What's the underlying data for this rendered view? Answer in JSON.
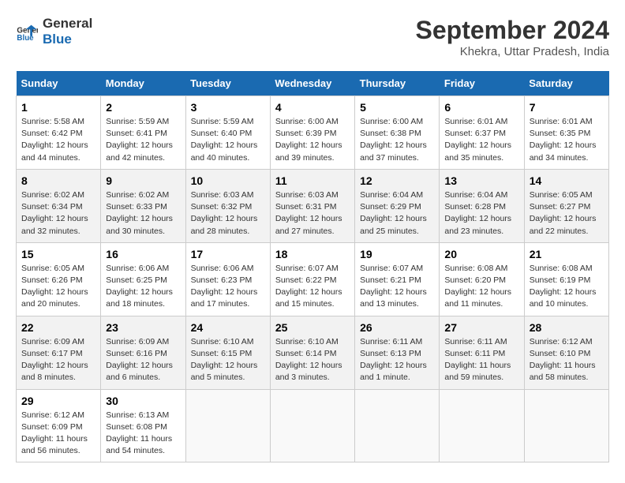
{
  "header": {
    "logo_line1": "General",
    "logo_line2": "Blue",
    "month_year": "September 2024",
    "location": "Khekra, Uttar Pradesh, India"
  },
  "days_of_week": [
    "Sunday",
    "Monday",
    "Tuesday",
    "Wednesday",
    "Thursday",
    "Friday",
    "Saturday"
  ],
  "weeks": [
    [
      {
        "day": "1",
        "info": "Sunrise: 5:58 AM\nSunset: 6:42 PM\nDaylight: 12 hours\nand 44 minutes."
      },
      {
        "day": "2",
        "info": "Sunrise: 5:59 AM\nSunset: 6:41 PM\nDaylight: 12 hours\nand 42 minutes."
      },
      {
        "day": "3",
        "info": "Sunrise: 5:59 AM\nSunset: 6:40 PM\nDaylight: 12 hours\nand 40 minutes."
      },
      {
        "day": "4",
        "info": "Sunrise: 6:00 AM\nSunset: 6:39 PM\nDaylight: 12 hours\nand 39 minutes."
      },
      {
        "day": "5",
        "info": "Sunrise: 6:00 AM\nSunset: 6:38 PM\nDaylight: 12 hours\nand 37 minutes."
      },
      {
        "day": "6",
        "info": "Sunrise: 6:01 AM\nSunset: 6:37 PM\nDaylight: 12 hours\nand 35 minutes."
      },
      {
        "day": "7",
        "info": "Sunrise: 6:01 AM\nSunset: 6:35 PM\nDaylight: 12 hours\nand 34 minutes."
      }
    ],
    [
      {
        "day": "8",
        "info": "Sunrise: 6:02 AM\nSunset: 6:34 PM\nDaylight: 12 hours\nand 32 minutes."
      },
      {
        "day": "9",
        "info": "Sunrise: 6:02 AM\nSunset: 6:33 PM\nDaylight: 12 hours\nand 30 minutes."
      },
      {
        "day": "10",
        "info": "Sunrise: 6:03 AM\nSunset: 6:32 PM\nDaylight: 12 hours\nand 28 minutes."
      },
      {
        "day": "11",
        "info": "Sunrise: 6:03 AM\nSunset: 6:31 PM\nDaylight: 12 hours\nand 27 minutes."
      },
      {
        "day": "12",
        "info": "Sunrise: 6:04 AM\nSunset: 6:29 PM\nDaylight: 12 hours\nand 25 minutes."
      },
      {
        "day": "13",
        "info": "Sunrise: 6:04 AM\nSunset: 6:28 PM\nDaylight: 12 hours\nand 23 minutes."
      },
      {
        "day": "14",
        "info": "Sunrise: 6:05 AM\nSunset: 6:27 PM\nDaylight: 12 hours\nand 22 minutes."
      }
    ],
    [
      {
        "day": "15",
        "info": "Sunrise: 6:05 AM\nSunset: 6:26 PM\nDaylight: 12 hours\nand 20 minutes."
      },
      {
        "day": "16",
        "info": "Sunrise: 6:06 AM\nSunset: 6:25 PM\nDaylight: 12 hours\nand 18 minutes."
      },
      {
        "day": "17",
        "info": "Sunrise: 6:06 AM\nSunset: 6:23 PM\nDaylight: 12 hours\nand 17 minutes."
      },
      {
        "day": "18",
        "info": "Sunrise: 6:07 AM\nSunset: 6:22 PM\nDaylight: 12 hours\nand 15 minutes."
      },
      {
        "day": "19",
        "info": "Sunrise: 6:07 AM\nSunset: 6:21 PM\nDaylight: 12 hours\nand 13 minutes."
      },
      {
        "day": "20",
        "info": "Sunrise: 6:08 AM\nSunset: 6:20 PM\nDaylight: 12 hours\nand 11 minutes."
      },
      {
        "day": "21",
        "info": "Sunrise: 6:08 AM\nSunset: 6:19 PM\nDaylight: 12 hours\nand 10 minutes."
      }
    ],
    [
      {
        "day": "22",
        "info": "Sunrise: 6:09 AM\nSunset: 6:17 PM\nDaylight: 12 hours\nand 8 minutes."
      },
      {
        "day": "23",
        "info": "Sunrise: 6:09 AM\nSunset: 6:16 PM\nDaylight: 12 hours\nand 6 minutes."
      },
      {
        "day": "24",
        "info": "Sunrise: 6:10 AM\nSunset: 6:15 PM\nDaylight: 12 hours\nand 5 minutes."
      },
      {
        "day": "25",
        "info": "Sunrise: 6:10 AM\nSunset: 6:14 PM\nDaylight: 12 hours\nand 3 minutes."
      },
      {
        "day": "26",
        "info": "Sunrise: 6:11 AM\nSunset: 6:13 PM\nDaylight: 12 hours\nand 1 minute."
      },
      {
        "day": "27",
        "info": "Sunrise: 6:11 AM\nSunset: 6:11 PM\nDaylight: 11 hours\nand 59 minutes."
      },
      {
        "day": "28",
        "info": "Sunrise: 6:12 AM\nSunset: 6:10 PM\nDaylight: 11 hours\nand 58 minutes."
      }
    ],
    [
      {
        "day": "29",
        "info": "Sunrise: 6:12 AM\nSunset: 6:09 PM\nDaylight: 11 hours\nand 56 minutes."
      },
      {
        "day": "30",
        "info": "Sunrise: 6:13 AM\nSunset: 6:08 PM\nDaylight: 11 hours\nand 54 minutes."
      },
      {
        "day": "",
        "info": ""
      },
      {
        "day": "",
        "info": ""
      },
      {
        "day": "",
        "info": ""
      },
      {
        "day": "",
        "info": ""
      },
      {
        "day": "",
        "info": ""
      }
    ]
  ]
}
